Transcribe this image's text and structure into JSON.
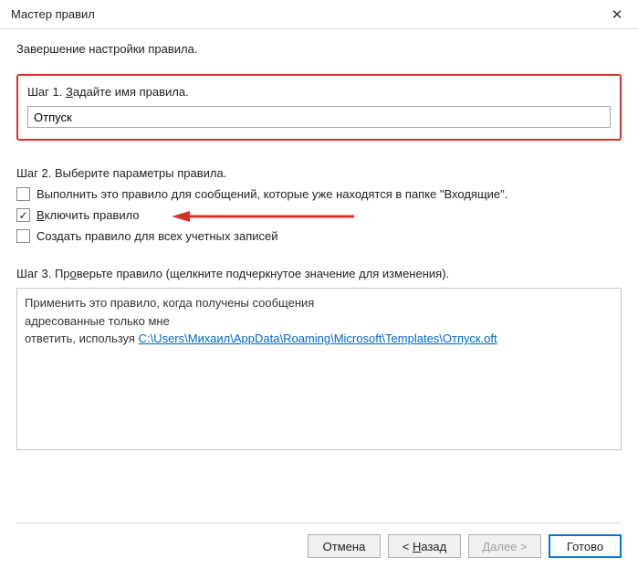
{
  "titlebar": {
    "title": "Мастер правил"
  },
  "subtitle": "Завершение настройки правила.",
  "step1": {
    "label_prefix": "Шаг 1. ",
    "label_underline": "З",
    "label_rest": "адайте имя правила.",
    "value": "Отпуск"
  },
  "step2": {
    "label": "Шаг 2. Выберите параметры правила.",
    "opts": [
      {
        "label": "Выполнить это правило для сообщений, которые уже находятся в папке \"Входящие\".",
        "checked": false
      },
      {
        "label_underline": "В",
        "label_rest": "ключить правило",
        "checked": true
      },
      {
        "label": "Создать правило для всех учетных записей",
        "checked": false
      }
    ]
  },
  "step3": {
    "label_prefix": "Шаг 3. Пр",
    "label_underline": "о",
    "label_rest": "верьте правило (щелкните подчеркнутое значение для изменения).",
    "preview": {
      "line1": "Применить это правило, когда получены сообщения",
      "line2": "адресованные только мне",
      "line3_prefix": "ответить, используя ",
      "link": "C:\\Users\\Михаил\\AppData\\Roaming\\Microsoft\\Templates\\Отпуск.oft"
    }
  },
  "buttons": {
    "cancel": "Отмена",
    "back_prefix": "< ",
    "back_underline": "Н",
    "back_rest": "азад",
    "next_underline": "Д",
    "next_rest": "алее >",
    "finish": "Готово"
  }
}
